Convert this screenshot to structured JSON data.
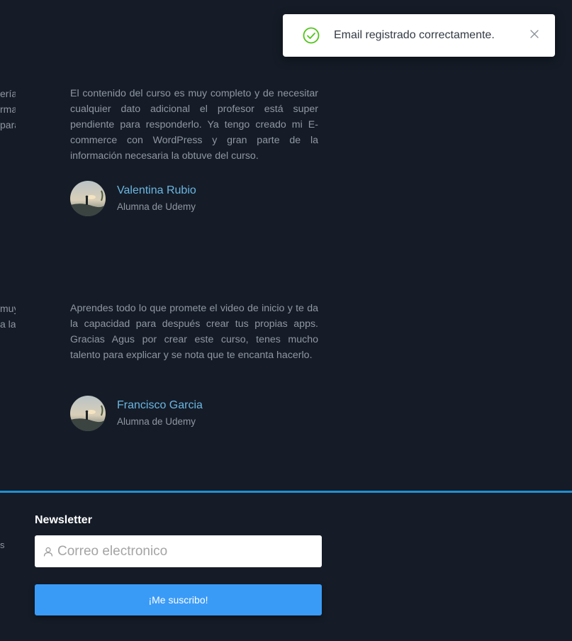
{
  "toast": {
    "message": "Email registrado correctamente.",
    "success_color": "#52c41a"
  },
  "clipped_left": {
    "review1": [
      "ería,",
      "rma",
      "para"
    ],
    "review2": [
      "muy",
      "a la"
    ],
    "footer": "s"
  },
  "reviews": [
    {
      "text": "El contenido del curso es muy completo y de necesitar cualquier dato adicional el profesor está super pendiente para responderlo. Ya tengo creado mi E-commerce con WordPress y gran parte de la información necesaria la obtuve del curso.",
      "name": "Valentina Rubio",
      "role": "Alumna de Udemy"
    },
    {
      "text": "Aprendes todo lo que promete el video de inicio y te da la capacidad para después crear tus propias apps. Gracias Agus por crear este curso, tenes mucho talento para explicar y se nota que te encanta hacerlo.",
      "name": "Francisco Garcia",
      "role": "Alumna de Udemy"
    }
  ],
  "newsletter": {
    "title": "Newsletter",
    "placeholder": "Correo electronico",
    "button_label": "¡Me suscribo!"
  },
  "colors": {
    "background": "#151c27",
    "accent": "#1f8fd1",
    "button": "#3a9bf7",
    "author_name": "#6bb6e2"
  },
  "icons": {
    "toast_status": "check-circle-icon",
    "toast_close": "close-icon",
    "input_prefix": "user-icon"
  }
}
